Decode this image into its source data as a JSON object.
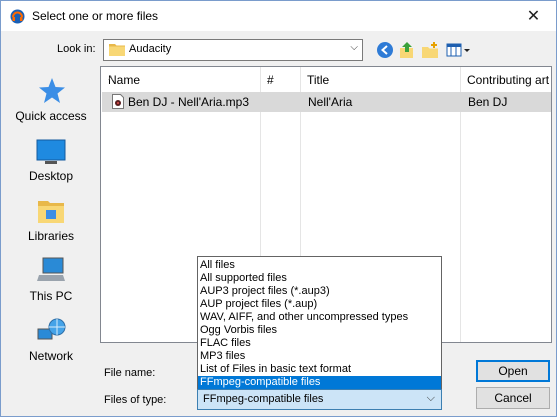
{
  "window": {
    "title": "Select one or more files",
    "close_glyph": "✕"
  },
  "lookin": {
    "label": "Look in:",
    "value": "Audacity"
  },
  "toolbar": {
    "back_icon": "back-icon",
    "up_icon": "up-folder-icon",
    "newfolder_icon": "new-folder-icon",
    "view_icon": "view-menu-icon"
  },
  "places": [
    {
      "label": "Quick access",
      "icon": "star-icon"
    },
    {
      "label": "Desktop",
      "icon": "desktop-icon"
    },
    {
      "label": "Libraries",
      "icon": "libraries-icon"
    },
    {
      "label": "This PC",
      "icon": "computer-icon"
    },
    {
      "label": "Network",
      "icon": "network-icon"
    }
  ],
  "list": {
    "columns": [
      "Name",
      "#",
      "Title",
      "Contributing art"
    ],
    "rows": [
      {
        "name": "Ben DJ - Nell'Aria.mp3",
        "num": "",
        "title": "Nell'Aria",
        "artist": "Ben DJ"
      }
    ]
  },
  "filename": {
    "label": "File name:",
    "value": ""
  },
  "filetype": {
    "label": "Files of type:",
    "value": "FFmpeg-compatible files",
    "options": [
      "All files",
      "All supported files",
      "AUP3 project files (*.aup3)",
      "AUP project files (*.aup)",
      "WAV, AIFF, and other uncompressed types",
      "Ogg Vorbis files",
      "FLAC files",
      "MP3 files",
      "List of Files in basic text format",
      "FFmpeg-compatible files"
    ],
    "selected_index": 9
  },
  "buttons": {
    "open": "Open",
    "cancel": "Cancel"
  },
  "colors": {
    "accent": "#0078d7",
    "row_selected": "#d9d9d9"
  }
}
